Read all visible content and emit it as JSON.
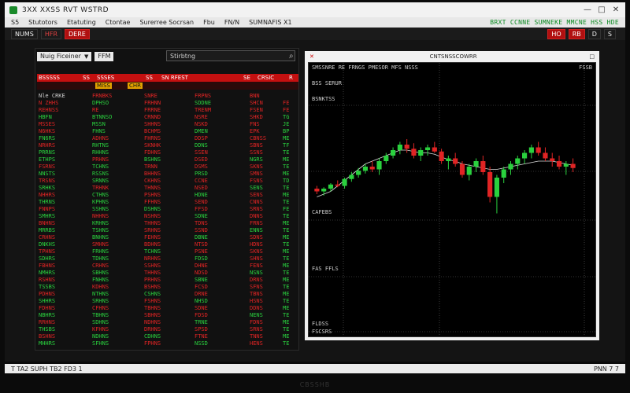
{
  "window": {
    "title": "3XX XXSS RVT WSTRD",
    "controls": [
      "—",
      "□",
      "✕"
    ]
  },
  "menu": {
    "items": [
      "S5",
      "Stutotors",
      "Etatuting",
      "Ctontae",
      "Surerree Socrsan",
      "Fbu",
      "FN/N",
      "SUMNAFIS X1"
    ],
    "ticker": "BRXT CCNNE SUMNEKE MMCNE HSS HDE"
  },
  "toolbar": {
    "left_buttons": [
      "NUMS",
      "HFR",
      "DERE"
    ],
    "right_buttons": [
      "HO",
      "RB",
      "D",
      "S"
    ]
  },
  "left_panel": {
    "dropdown1": "Nuig Ficeiner",
    "dropdown2": "FFM",
    "search_value": "Stirbtng",
    "header": [
      "BSSSSS",
      "SS",
      "SSSES",
      "SS",
      "SN RFEST",
      "SE",
      "CRSIC",
      "R"
    ],
    "sub_header": [
      "MISS",
      "CHR"
    ],
    "rows": [
      {
        "c": [
          "Nle CRKE",
          "FRNBKS",
          "SNRE",
          "FRPNS",
          "BNN",
          ""
        ],
        "s": [
          "nt",
          "dn",
          "dn",
          "dn",
          "dn",
          "nt"
        ]
      },
      {
        "c": [
          "N ZHHS",
          "DPHSO",
          "FRHNN",
          "SDDNE",
          "SHCN",
          "FE"
        ],
        "s": [
          "dn",
          "up",
          "dn",
          "up",
          "dn",
          "dn"
        ]
      },
      {
        "c": [
          "REHNSS",
          "RE",
          "FRRNE",
          "TRENM",
          "FSEN",
          "FE"
        ],
        "s": [
          "dn",
          "dn",
          "dn",
          "dn",
          "dn",
          "dn"
        ]
      },
      {
        "c": [
          "HBFN",
          "BTNNSO",
          "CRNND",
          "NSRE",
          "SHKD",
          "TG"
        ],
        "s": [
          "up",
          "up",
          "dn",
          "dn",
          "dn",
          "up"
        ]
      },
      {
        "c": [
          "MSSES",
          "MSSN",
          "SHHNS",
          "NSKD",
          "FNS",
          "JE"
        ],
        "s": [
          "dn",
          "up",
          "dn",
          "dn",
          "dn",
          "up"
        ]
      },
      {
        "c": [
          "N6HKS",
          "FHNS",
          "BCHMS",
          "DMEN",
          "EPK",
          "BP"
        ],
        "s": [
          "dn",
          "up",
          "dn",
          "up",
          "dn",
          "up"
        ]
      },
      {
        "c": [
          "FN6RS",
          "ADHNS",
          "FHRNS",
          "DDSP",
          "CBNSS",
          "ME"
        ],
        "s": [
          "up",
          "dn",
          "dn",
          "dn",
          "dn",
          "up"
        ]
      },
      {
        "c": [
          "NRHRS",
          "RHTNS",
          "SKNHK",
          "DDNS",
          "SBNS",
          "TF"
        ],
        "s": [
          "dn",
          "up",
          "dn",
          "up",
          "dn",
          "up"
        ]
      },
      {
        "c": [
          "PRRNS",
          "RHHNS",
          "FDHNS",
          "SSEN",
          "SSNS",
          "TE"
        ],
        "s": [
          "up",
          "up",
          "dn",
          "dn",
          "dn",
          "up"
        ]
      },
      {
        "c": [
          "ETHPS",
          "PRHNS",
          "BSHNS",
          "DSED",
          "NGRS",
          "ME"
        ],
        "s": [
          "up",
          "dn",
          "up",
          "dn",
          "up",
          "up"
        ]
      },
      {
        "c": [
          "FSRNS",
          "TCHNS",
          "TRNN",
          "DSMS",
          "SKNS",
          "TE"
        ],
        "s": [
          "dn",
          "up",
          "dn",
          "dn",
          "dn",
          "up"
        ]
      },
      {
        "c": [
          "NNSTS",
          "RSSNS",
          "BHHNS",
          "PRSD",
          "SMNS",
          "ME"
        ],
        "s": [
          "up",
          "up",
          "dn",
          "up",
          "dn",
          "up"
        ]
      },
      {
        "c": [
          "TRSNS",
          "SRNNS",
          "CKHNS",
          "CCNE",
          "FSNS",
          "TD"
        ],
        "s": [
          "dn",
          "up",
          "dn",
          "dn",
          "dn",
          "up"
        ]
      },
      {
        "c": [
          "SRHKS",
          "TRHNK",
          "THNNS",
          "NSED",
          "SENS",
          "TE"
        ],
        "s": [
          "up",
          "dn",
          "dn",
          "dn",
          "up",
          "up"
        ]
      },
      {
        "c": [
          "NHHRS",
          "CTHNS",
          "PSHNS",
          "HDNE",
          "SENS",
          "ME"
        ],
        "s": [
          "dn",
          "up",
          "dn",
          "up",
          "dn",
          "up"
        ]
      },
      {
        "c": [
          "THRNS",
          "KPHNS",
          "FFHNS",
          "SEND",
          "CNNS",
          "TE"
        ],
        "s": [
          "up",
          "up",
          "dn",
          "dn",
          "dn",
          "up"
        ]
      },
      {
        "c": [
          "FNNPS",
          "SSHNS",
          "DSHNS",
          "FFSD",
          "SRNS",
          "FE"
        ],
        "s": [
          "dn",
          "up",
          "up",
          "dn",
          "dn",
          "up"
        ]
      },
      {
        "c": [
          "SMHRS",
          "NHHNS",
          "NSHNS",
          "SDNE",
          "DNNS",
          "TE"
        ],
        "s": [
          "up",
          "dn",
          "dn",
          "up",
          "dn",
          "up"
        ]
      },
      {
        "c": [
          "BNHNS",
          "KRHNS",
          "THHNS",
          "TDNS",
          "FRNS",
          "ME"
        ],
        "s": [
          "dn",
          "up",
          "dn",
          "dn",
          "dn",
          "up"
        ]
      },
      {
        "c": [
          "MRRBS",
          "TSHNS",
          "SRHNS",
          "SSND",
          "ENNS",
          "TE"
        ],
        "s": [
          "up",
          "up",
          "dn",
          "dn",
          "up",
          "up"
        ]
      },
      {
        "c": [
          "CRHNS",
          "BNHNS",
          "FEHNS",
          "DBNE",
          "SDNS",
          "ME"
        ],
        "s": [
          "dn",
          "up",
          "dn",
          "up",
          "dn",
          "up"
        ]
      },
      {
        "c": [
          "DNKHS",
          "SMHNS",
          "BDHNS",
          "NTSD",
          "HDNS",
          "TE"
        ],
        "s": [
          "up",
          "dn",
          "dn",
          "dn",
          "dn",
          "up"
        ]
      },
      {
        "c": [
          "TPHNS",
          "FRHNS",
          "TCHNS",
          "PSNE",
          "SKNS",
          "ME"
        ],
        "s": [
          "dn",
          "up",
          "up",
          "dn",
          "dn",
          "up"
        ]
      },
      {
        "c": [
          "SDHRS",
          "TDHNS",
          "NRHNS",
          "FDSD",
          "SHNS",
          "TE"
        ],
        "s": [
          "up",
          "up",
          "dn",
          "up",
          "dn",
          "up"
        ]
      },
      {
        "c": [
          "FBHNS",
          "CRHNS",
          "SSHNS",
          "DHNE",
          "FENS",
          "ME"
        ],
        "s": [
          "dn",
          "dn",
          "dn",
          "dn",
          "dn",
          "up"
        ]
      },
      {
        "c": [
          "NMHRS",
          "SBHNS",
          "THHNS",
          "NDSD",
          "NSNS",
          "TE"
        ],
        "s": [
          "up",
          "up",
          "dn",
          "dn",
          "up",
          "up"
        ]
      },
      {
        "c": [
          "RSHNS",
          "FNHNS",
          "PRHNS",
          "SBNE",
          "DRNS",
          "ME"
        ],
        "s": [
          "dn",
          "up",
          "dn",
          "up",
          "dn",
          "up"
        ]
      },
      {
        "c": [
          "TSSBS",
          "KDHNS",
          "BSHNS",
          "FCSD",
          "SFNS",
          "TE"
        ],
        "s": [
          "up",
          "dn",
          "dn",
          "dn",
          "dn",
          "up"
        ]
      },
      {
        "c": [
          "PDHNS",
          "NTHNS",
          "CSHNS",
          "DRNE",
          "TBNS",
          "ME"
        ],
        "s": [
          "dn",
          "up",
          "up",
          "dn",
          "dn",
          "up"
        ]
      },
      {
        "c": [
          "SHHRS",
          "SRHNS",
          "FSHNS",
          "NHSD",
          "HSNS",
          "TE"
        ],
        "s": [
          "up",
          "up",
          "dn",
          "up",
          "dn",
          "up"
        ]
      },
      {
        "c": [
          "FDHNS",
          "CFHNS",
          "TBHNS",
          "SDNE",
          "DDNS",
          "ME"
        ],
        "s": [
          "dn",
          "dn",
          "dn",
          "dn",
          "dn",
          "up"
        ]
      },
      {
        "c": [
          "NBHRS",
          "TBHNS",
          "SBHNS",
          "FDSD",
          "NENS",
          "TE"
        ],
        "s": [
          "up",
          "up",
          "dn",
          "dn",
          "up",
          "up"
        ]
      },
      {
        "c": [
          "RRHNS",
          "SDHNS",
          "NDHNS",
          "TRNE",
          "FDNS",
          "ME"
        ],
        "s": [
          "dn",
          "up",
          "dn",
          "up",
          "dn",
          "up"
        ]
      },
      {
        "c": [
          "THSBS",
          "KFHNS",
          "DRHNS",
          "SPSD",
          "SRNS",
          "TE"
        ],
        "s": [
          "up",
          "dn",
          "dn",
          "dn",
          "dn",
          "up"
        ]
      },
      {
        "c": [
          "BSHNS",
          "NDHNS",
          "CDHNS",
          "FTNE",
          "TNNS",
          "ME"
        ],
        "s": [
          "dn",
          "up",
          "up",
          "dn",
          "dn",
          "up"
        ]
      },
      {
        "c": [
          "MHHRS",
          "SFHNS",
          "FPHNS",
          "NSSD",
          "HENS",
          "TE"
        ],
        "s": [
          "up",
          "up",
          "dn",
          "up",
          "dn",
          "up"
        ]
      }
    ]
  },
  "chart_panel": {
    "title": "CNTSNSSCOWRR",
    "info_line": "SMSSNRE RE FRNGS PMESOR MFS NSSS",
    "last_label": "FSSB",
    "pane_labels": [
      "BSS SERUR",
      "BSNKTSS",
      "CAFEBS",
      "FAS FFLS",
      "FLDSS",
      "FSCSRS"
    ]
  },
  "chart_data": {
    "type": "candlestick",
    "title": "",
    "xlabel": "",
    "ylabel": "",
    "ylim": [
      0,
      100
    ],
    "candles": [
      [
        40,
        42,
        36,
        38
      ],
      [
        38,
        41,
        35,
        40
      ],
      [
        40,
        44,
        38,
        43
      ],
      [
        43,
        46,
        41,
        42
      ],
      [
        42,
        48,
        40,
        47
      ],
      [
        47,
        52,
        45,
        50
      ],
      [
        50,
        55,
        48,
        53
      ],
      [
        53,
        58,
        51,
        56
      ],
      [
        56,
        60,
        52,
        54
      ],
      [
        54,
        62,
        50,
        60
      ],
      [
        60,
        66,
        58,
        64
      ],
      [
        64,
        70,
        62,
        68
      ],
      [
        68,
        74,
        65,
        72
      ],
      [
        72,
        76,
        66,
        69
      ],
      [
        69,
        73,
        62,
        64
      ],
      [
        64,
        70,
        60,
        68
      ],
      [
        68,
        72,
        64,
        70
      ],
      [
        70,
        74,
        66,
        67
      ],
      [
        67,
        69,
        58,
        60
      ],
      [
        60,
        64,
        54,
        62
      ],
      [
        62,
        66,
        56,
        58
      ],
      [
        58,
        60,
        48,
        50
      ],
      [
        50,
        58,
        46,
        56
      ],
      [
        56,
        62,
        52,
        60
      ],
      [
        60,
        64,
        50,
        52
      ],
      [
        52,
        56,
        30,
        34
      ],
      [
        34,
        50,
        22,
        48
      ],
      [
        48,
        56,
        44,
        54
      ],
      [
        54,
        60,
        50,
        58
      ],
      [
        58,
        64,
        54,
        62
      ],
      [
        62,
        68,
        58,
        66
      ],
      [
        66,
        72,
        62,
        70
      ],
      [
        70,
        74,
        64,
        66
      ],
      [
        66,
        70,
        60,
        62
      ],
      [
        62,
        66,
        56,
        60
      ],
      [
        60,
        64,
        54,
        56
      ],
      [
        56,
        60,
        50,
        58
      ],
      [
        58,
        62,
        52,
        55
      ]
    ],
    "overlay": [
      34,
      36,
      38,
      42,
      46,
      50,
      54,
      58,
      60,
      62,
      64,
      66,
      68,
      68,
      67,
      66,
      66,
      65,
      63,
      61,
      60,
      58,
      57,
      56,
      55,
      54,
      54,
      55,
      56,
      57,
      58,
      59,
      60,
      60,
      60,
      59,
      58,
      57
    ],
    "colors": {
      "up": "#2ad13e",
      "down": "#e02424",
      "overlay": "#dddddd"
    }
  },
  "status": {
    "left": "T TA2 SUPH TB2 FD3 1",
    "right": "PNN 7 7"
  },
  "bezel": {
    "brand": "CBSSHB"
  }
}
